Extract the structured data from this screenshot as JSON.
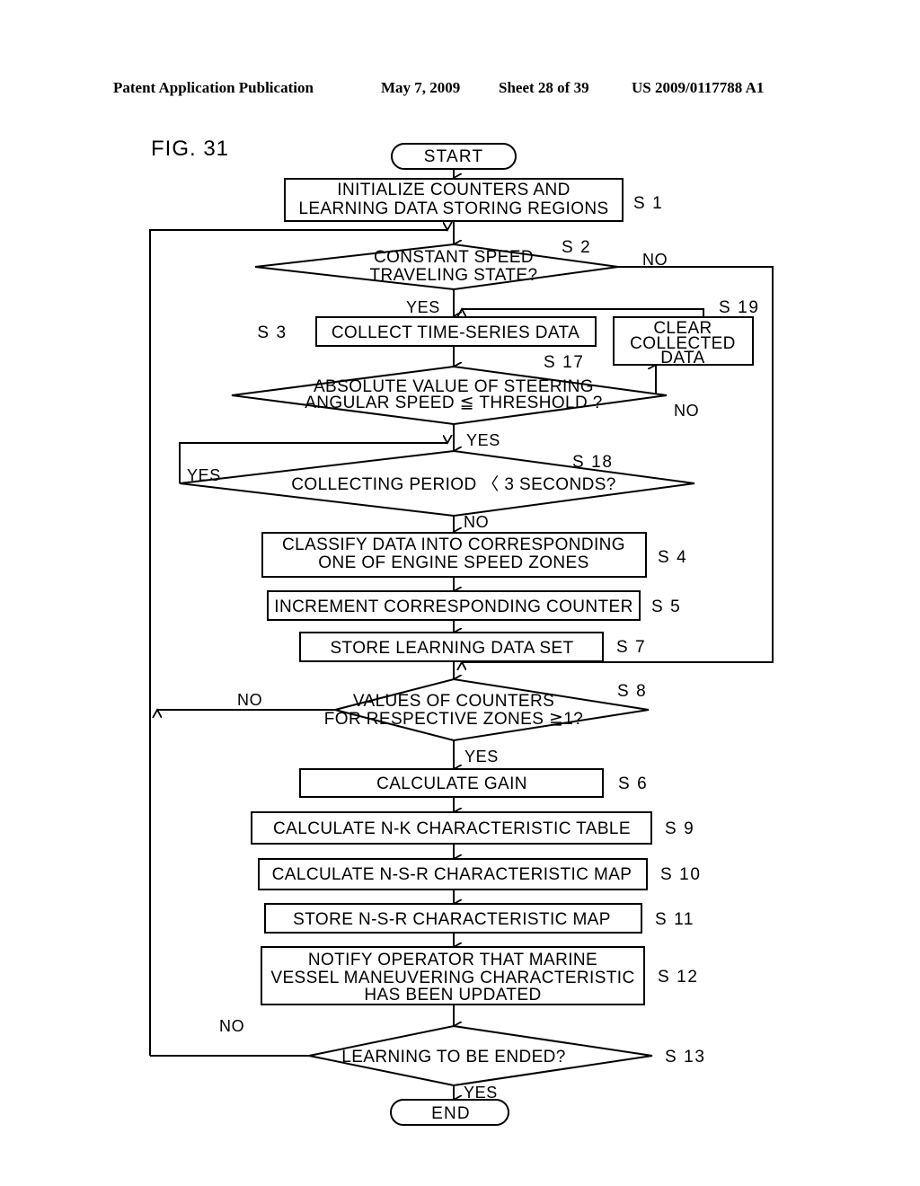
{
  "header": {
    "publication": "Patent Application Publication",
    "date": "May 7, 2009",
    "sheet": "Sheet 28 of 39",
    "number": "US 2009/0117788 A1"
  },
  "figure": {
    "label": "FIG. 31"
  },
  "flowchart": {
    "terminals": {
      "start": "START",
      "end": "END"
    },
    "nodes": [
      {
        "id": "S1",
        "step": "S 1",
        "kind": "process",
        "lines": [
          "INITIALIZE COUNTERS AND",
          "LEARNING DATA STORING REGIONS"
        ]
      },
      {
        "id": "S2",
        "step": "S 2",
        "kind": "decision",
        "lines": [
          "CONSTANT SPEED",
          "TRAVELING STATE?"
        ]
      },
      {
        "id": "S3",
        "step": "S 3",
        "kind": "process",
        "lines": [
          "COLLECT TIME-SERIES DATA"
        ]
      },
      {
        "id": "S19",
        "step": "S 19",
        "kind": "process",
        "lines": [
          "CLEAR",
          "COLLECTED",
          "DATA"
        ]
      },
      {
        "id": "S17",
        "step": "S 17",
        "kind": "decision",
        "lines": [
          "ABSOLUTE VALUE OF STEERING",
          "ANGULAR SPEED ≦ THRESHOLD ?"
        ]
      },
      {
        "id": "S18",
        "step": "S 18",
        "kind": "decision",
        "lines": [
          "COLLECTING PERIOD 〈 3 SECONDS?"
        ]
      },
      {
        "id": "S4",
        "step": "S 4",
        "kind": "process",
        "lines": [
          "CLASSIFY DATA INTO CORRESPONDING",
          "ONE OF ENGINE SPEED ZONES"
        ]
      },
      {
        "id": "S5",
        "step": "S 5",
        "kind": "process",
        "lines": [
          "INCREMENT CORRESPONDING COUNTER"
        ]
      },
      {
        "id": "S7",
        "step": "S 7",
        "kind": "process",
        "lines": [
          "STORE LEARNING DATA SET"
        ]
      },
      {
        "id": "S8",
        "step": "S 8",
        "kind": "decision",
        "lines": [
          "VALUES OF COUNTERS",
          "FOR RESPECTIVE ZONES ≧1?"
        ]
      },
      {
        "id": "S6",
        "step": "S 6",
        "kind": "process",
        "lines": [
          "CALCULATE GAIN"
        ]
      },
      {
        "id": "S9",
        "step": "S 9",
        "kind": "process",
        "lines": [
          "CALCULATE N-K CHARACTERISTIC TABLE"
        ]
      },
      {
        "id": "S10",
        "step": "S 10",
        "kind": "process",
        "lines": [
          "CALCULATE N-S-R CHARACTERISTIC MAP"
        ]
      },
      {
        "id": "S11",
        "step": "S 11",
        "kind": "process",
        "lines": [
          "STORE N-S-R CHARACTERISTIC MAP"
        ]
      },
      {
        "id": "S12",
        "step": "S 12",
        "kind": "process",
        "lines": [
          "NOTIFY OPERATOR THAT MARINE",
          "VESSEL MANEUVERING CHARACTERISTIC",
          "HAS BEEN UPDATED"
        ]
      },
      {
        "id": "S13",
        "step": "S 13",
        "kind": "decision",
        "lines": [
          "LEARNING TO BE ENDED?"
        ]
      }
    ],
    "branch_labels": {
      "s2_no": "NO",
      "s2_yes": "YES",
      "s17_no": "NO",
      "s17_yes": "YES",
      "s18_yes": "YES",
      "s18_no": "NO",
      "s8_no": "NO",
      "s8_yes": "YES",
      "s13_no": "NO",
      "s13_yes": "YES"
    }
  },
  "colors": {
    "ink": "#000000",
    "paper": "#ffffff"
  }
}
